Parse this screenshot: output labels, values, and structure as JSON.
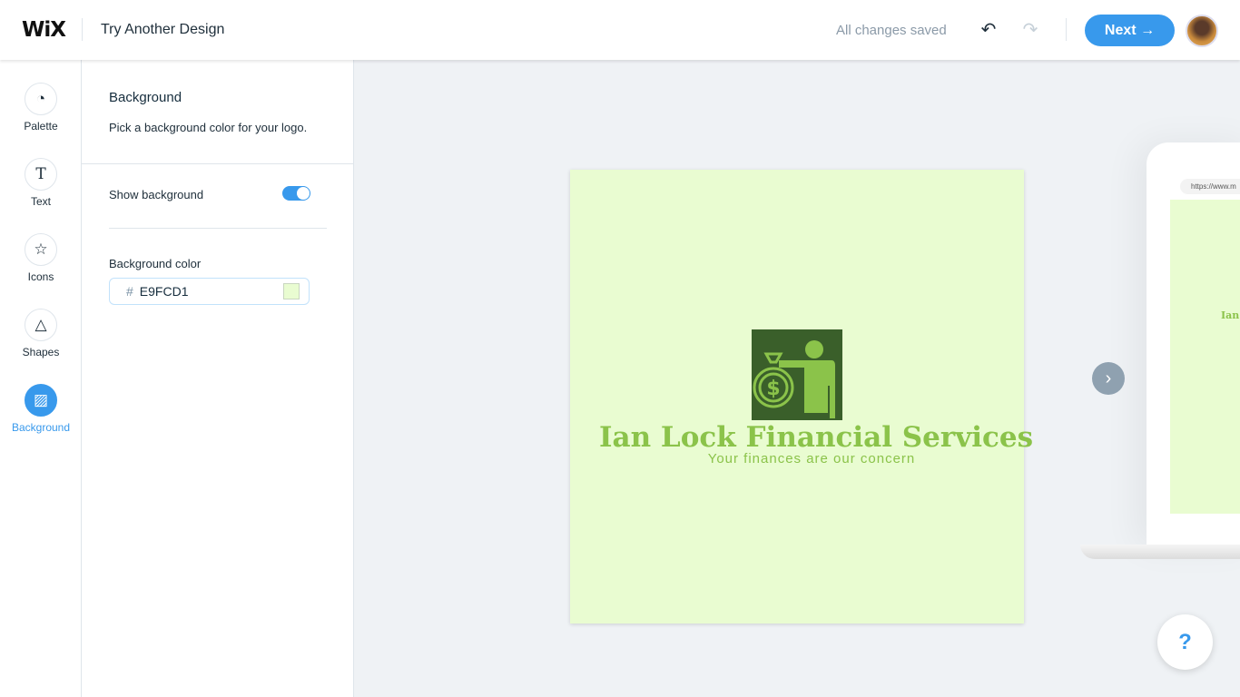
{
  "header": {
    "brand": "WiX",
    "title": "Try Another Design",
    "status": "All changes saved",
    "undo_icon": "↶",
    "redo_icon": "↷",
    "next_label": "Next",
    "next_icon": "→"
  },
  "rail": [
    {
      "label": "Palette",
      "icon": "◔"
    },
    {
      "label": "Text",
      "icon": "T"
    },
    {
      "label": "Icons",
      "icon": "☆"
    },
    {
      "label": "Shapes",
      "icon": "△"
    },
    {
      "label": "Background",
      "icon": "▨"
    }
  ],
  "panel": {
    "heading": "Background",
    "description": "Pick a background color for your logo.",
    "show_background_label": "Show background",
    "show_background": true,
    "color_label": "Background color",
    "hash": "#",
    "color_value": "E9FCD1"
  },
  "logo": {
    "name": "Ian Lock Financial Services",
    "tagline": "Your finances are our concern",
    "background": "#E9FCD1",
    "icon_bg": "#3a5f2a",
    "accent": "#8bc34a"
  },
  "preview": {
    "url": "https://www.m",
    "mini_name": "Ian",
    "next_icon": "›"
  },
  "help": {
    "label": "?"
  },
  "colors": {
    "accent": "#3899ec"
  }
}
